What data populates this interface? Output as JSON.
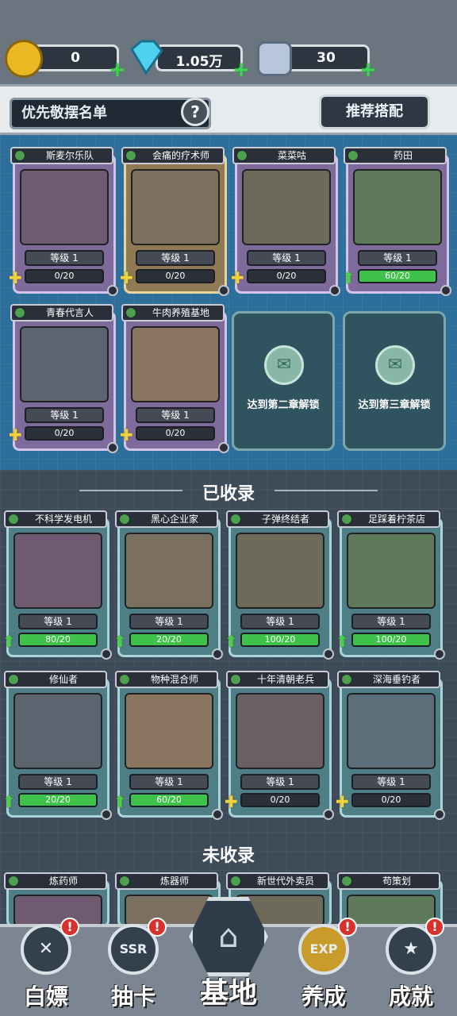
{
  "resources": [
    {
      "name": "gold",
      "value": "0",
      "icon": "coin-icon"
    },
    {
      "name": "diamond",
      "value": "1.05万",
      "icon": "diamond-icon"
    },
    {
      "name": "energy",
      "value": "30",
      "icon": "energy-can-icon"
    }
  ],
  "header": {
    "title": "优先敬摆名单",
    "help_label": "?",
    "recommend_label": "推荐搭配"
  },
  "priority_cards": [
    {
      "name": "斯麦尔乐队",
      "level": "等级 1",
      "progress": "0/20",
      "progress_pct": 0,
      "icon": "puzzle-icon",
      "style": "purple"
    },
    {
      "name": "会痛的疗术师",
      "level": "等级 1",
      "progress": "0/20",
      "progress_pct": 0,
      "icon": "puzzle-icon",
      "style": "gold"
    },
    {
      "name": "菜菜咕",
      "level": "等级 1",
      "progress": "0/20",
      "progress_pct": 0,
      "icon": "puzzle-icon",
      "style": "purple"
    },
    {
      "name": "药田",
      "level": "等级 1",
      "progress": "60/20",
      "progress_pct": 100,
      "icon": "upgrade-arrow-icon",
      "style": "purple"
    },
    {
      "name": "青春代言人",
      "level": "等级 1",
      "progress": "0/20",
      "progress_pct": 0,
      "icon": "puzzle-icon",
      "style": "purple"
    },
    {
      "name": "牛肉养殖基地",
      "level": "等级 1",
      "progress": "0/20",
      "progress_pct": 0,
      "icon": "puzzle-icon",
      "style": "purple"
    }
  ],
  "locked_slots": [
    {
      "message": "达到第二章解锁"
    },
    {
      "message": "达到第三章解锁"
    }
  ],
  "sections": {
    "collected": "已收录",
    "uncollected": "未收录"
  },
  "collected_cards": [
    {
      "name": "不科学发电机",
      "level": "等级 1",
      "progress": "80/20",
      "progress_pct": 100,
      "icon": "upgrade-arrow-icon"
    },
    {
      "name": "黑心企业家",
      "level": "等级 1",
      "progress": "20/20",
      "progress_pct": 100,
      "icon": "upgrade-arrow-icon"
    },
    {
      "name": "子弹终结者",
      "level": "等级 1",
      "progress": "100/20",
      "progress_pct": 100,
      "icon": "upgrade-arrow-icon"
    },
    {
      "name": "足踩着柠茶店",
      "level": "等级 1",
      "progress": "100/20",
      "progress_pct": 100,
      "icon": "upgrade-arrow-icon"
    },
    {
      "name": "修仙者",
      "level": "等级 1",
      "progress": "20/20",
      "progress_pct": 100,
      "icon": "upgrade-arrow-icon"
    },
    {
      "name": "物种混合师",
      "level": "等级 1",
      "progress": "60/20",
      "progress_pct": 100,
      "icon": "upgrade-arrow-icon"
    },
    {
      "name": "十年清朝老兵",
      "level": "等级 1",
      "progress": "0/20",
      "progress_pct": 0,
      "icon": "puzzle-icon"
    },
    {
      "name": "深海垂钓者",
      "level": "等级 1",
      "progress": "0/20",
      "progress_pct": 0,
      "icon": "puzzle-icon"
    }
  ],
  "uncollected_cards": [
    {
      "name": "炼药师"
    },
    {
      "name": "炼器师"
    },
    {
      "name": "新世代外卖员"
    },
    {
      "name": "苟策划"
    }
  ],
  "nav": [
    {
      "label": "白嫖",
      "icon": "gift-icon",
      "badge": "!"
    },
    {
      "label": "抽卡",
      "icon": "ssr-card-icon",
      "badge": "!"
    },
    {
      "label": "基地",
      "icon": "base-icon",
      "badge": ""
    },
    {
      "label": "养成",
      "icon": "exp-icon",
      "badge": "!"
    },
    {
      "label": "成就",
      "icon": "trophy-icon",
      "badge": "!"
    }
  ],
  "colors": {
    "priority_bg": "#2d6f9a",
    "lower_bg": "#3e4b58",
    "progress_green": "#3fc24a",
    "badge_red": "#d8312c"
  }
}
